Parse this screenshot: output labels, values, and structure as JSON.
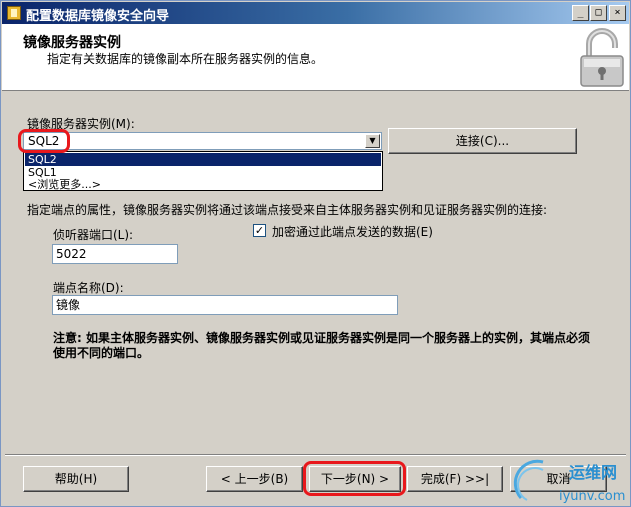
{
  "window": {
    "title": "配置数据库镜像安全向导",
    "minimize": "_",
    "maximize": "□",
    "close": "×"
  },
  "header": {
    "title": "镜像服务器实例",
    "subtitle": "指定有关数据库的镜像副本所在服务器实例的信息。"
  },
  "form": {
    "instance_label": "镜像服务器实例(M):",
    "instance_value": "SQL2",
    "instance_options": [
      "SQL2",
      "SQL1",
      "<浏览更多...>"
    ],
    "connect_button": "连接(C)...",
    "endpoint_desc": "指定端点的属性，镜像服务器实例将通过该端点接受来自主体服务器实例和见证服务器实例的连接:",
    "listener_port_label": "侦听器端口(L):",
    "listener_port_value": "5022",
    "encrypt_label": "加密通过此端点发送的数据(E)",
    "encrypt_checked": true,
    "endpoint_name_label": "端点名称(D):",
    "endpoint_name_value": "镜像",
    "note": "注意: 如果主体服务器实例、镜像服务器实例或见证服务器实例是同一个服务器上的实例，其端点必须使用不同的端口。"
  },
  "footer": {
    "help": "帮助(H)",
    "back": "< 上一步(B)",
    "next": "下一步(N) >",
    "finish": "完成(F) >>|",
    "cancel": "取消"
  },
  "watermark": {
    "line1": "运维网",
    "line2": "iyunv.com"
  },
  "colors": {
    "highlight": "#e8181c",
    "selection": "#0a246a"
  }
}
